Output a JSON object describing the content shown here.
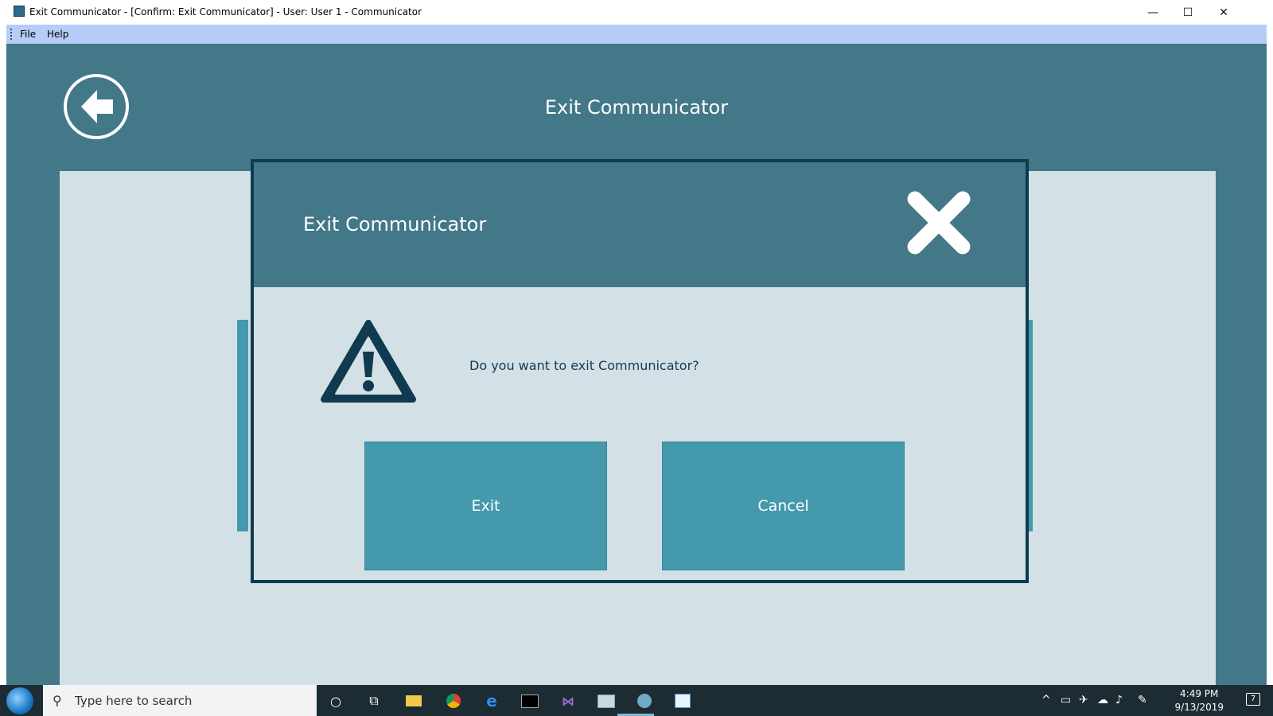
{
  "window": {
    "title": "Exit Communicator -  [Confirm: Exit Communicator] - User: User 1 - Communicator",
    "minimize_glyph": "—",
    "maximize_glyph": "☐",
    "close_glyph": "✕"
  },
  "menu": {
    "items": [
      "File",
      "Help"
    ]
  },
  "page": {
    "title": "Exit Communicator"
  },
  "dialog": {
    "title": "Exit Communicator",
    "message": "Do you want to exit Communicator?",
    "exit_label": "Exit",
    "cancel_label": "Cancel"
  },
  "taskbar": {
    "search_placeholder": "Type here to search",
    "time": "4:49 PM",
    "date": "9/13/2019",
    "notification_count": "7"
  },
  "colors": {
    "app_bg": "#437889",
    "panel_bg": "#d3e0e6",
    "button": "#4499ad",
    "dark": "#0f3a4f",
    "menubar": "#b5cdf7"
  }
}
